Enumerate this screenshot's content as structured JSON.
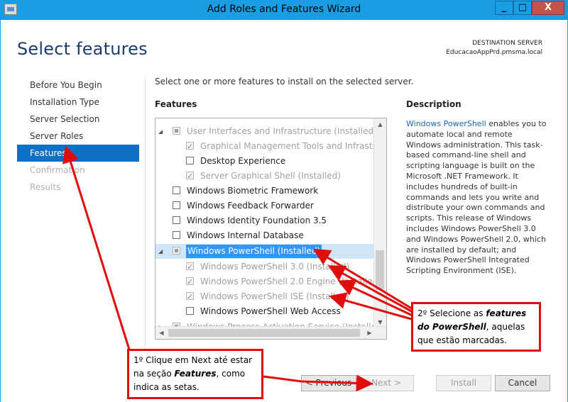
{
  "window": {
    "title": "Add Roles and Features Wizard",
    "minimize_symbol": "_",
    "maximize_symbol": "□",
    "close_symbol": "X"
  },
  "page": {
    "heading": "Select features",
    "destination_label": "DESTINATION SERVER",
    "destination_server": "EducacaoAppPrd.pmsma.local",
    "instruction": "Select one or more features to install on the selected server."
  },
  "nav": {
    "items": [
      {
        "label": "Before You Begin"
      },
      {
        "label": "Installation Type"
      },
      {
        "label": "Server Selection"
      },
      {
        "label": "Server Roles"
      },
      {
        "label": "Features"
      },
      {
        "label": "Confirmation"
      },
      {
        "label": "Results"
      }
    ]
  },
  "features": {
    "header": "Features",
    "rows": [
      {
        "label": "User Interfaces and Infrastructure (Installed)",
        "state": "partial",
        "expander": "◢"
      },
      {
        "label": "Graphical Management Tools and Infrastructure",
        "state": "checked"
      },
      {
        "label": "Desktop Experience",
        "state": "unchecked"
      },
      {
        "label": "Server Graphical Shell (Installed)",
        "state": "checked"
      },
      {
        "label": "Windows Biometric Framework",
        "state": "unchecked"
      },
      {
        "label": "Windows Feedback Forwarder",
        "state": "unchecked"
      },
      {
        "label": "Windows Identity Foundation 3.5",
        "state": "unchecked"
      },
      {
        "label": "Windows Internal Database",
        "state": "unchecked"
      },
      {
        "label": "Windows PowerShell (Installed)",
        "state": "partial",
        "expander": "◢"
      },
      {
        "label": "Windows PowerShell 3.0 (Installed)",
        "state": "checked"
      },
      {
        "label": "Windows PowerShell 2.0 Engine (Installed)",
        "state": "checked"
      },
      {
        "label": "Windows PowerShell ISE (Installed)",
        "state": "checked"
      },
      {
        "label": "Windows PowerShell Web Access",
        "state": "unchecked"
      },
      {
        "label": "Windows Process Activation Service (Installed)",
        "state": "partial",
        "expander": "▷"
      }
    ]
  },
  "description": {
    "header": "Description",
    "link_text": "Windows PowerShell",
    "text": " enables you to automate local and remote Windows administration. This task-based command-line shell and scripting language is built on the Microsoft .NET Framework. It includes hundreds of built-in commands and lets you write and distribute your own commands and scripts. This release of Windows includes Windows PowerShell 3.0 and Windows PowerShell 2.0, which are installed by default; and Windows PowerShell Integrated Scripting Environment (ISE)."
  },
  "buttons": {
    "previous": "< Previous",
    "next": "Next >",
    "install": "Install",
    "cancel": "Cancel"
  },
  "callouts": {
    "step2_prefix": "2º Selecione as ",
    "step2_bold": "features do PowerShell",
    "step2_suffix": ", aquelas que estão marcadas.",
    "step1_prefix": "1º Clique em Next até estar na seção ",
    "step1_bold": "Features",
    "step1_suffix": ", como indica as setas."
  },
  "colors": {
    "titlebar": "#1a9de2",
    "close_button": "#c7504a",
    "active_nav": "#1070c8",
    "annotation_red": "#e10d0d"
  }
}
